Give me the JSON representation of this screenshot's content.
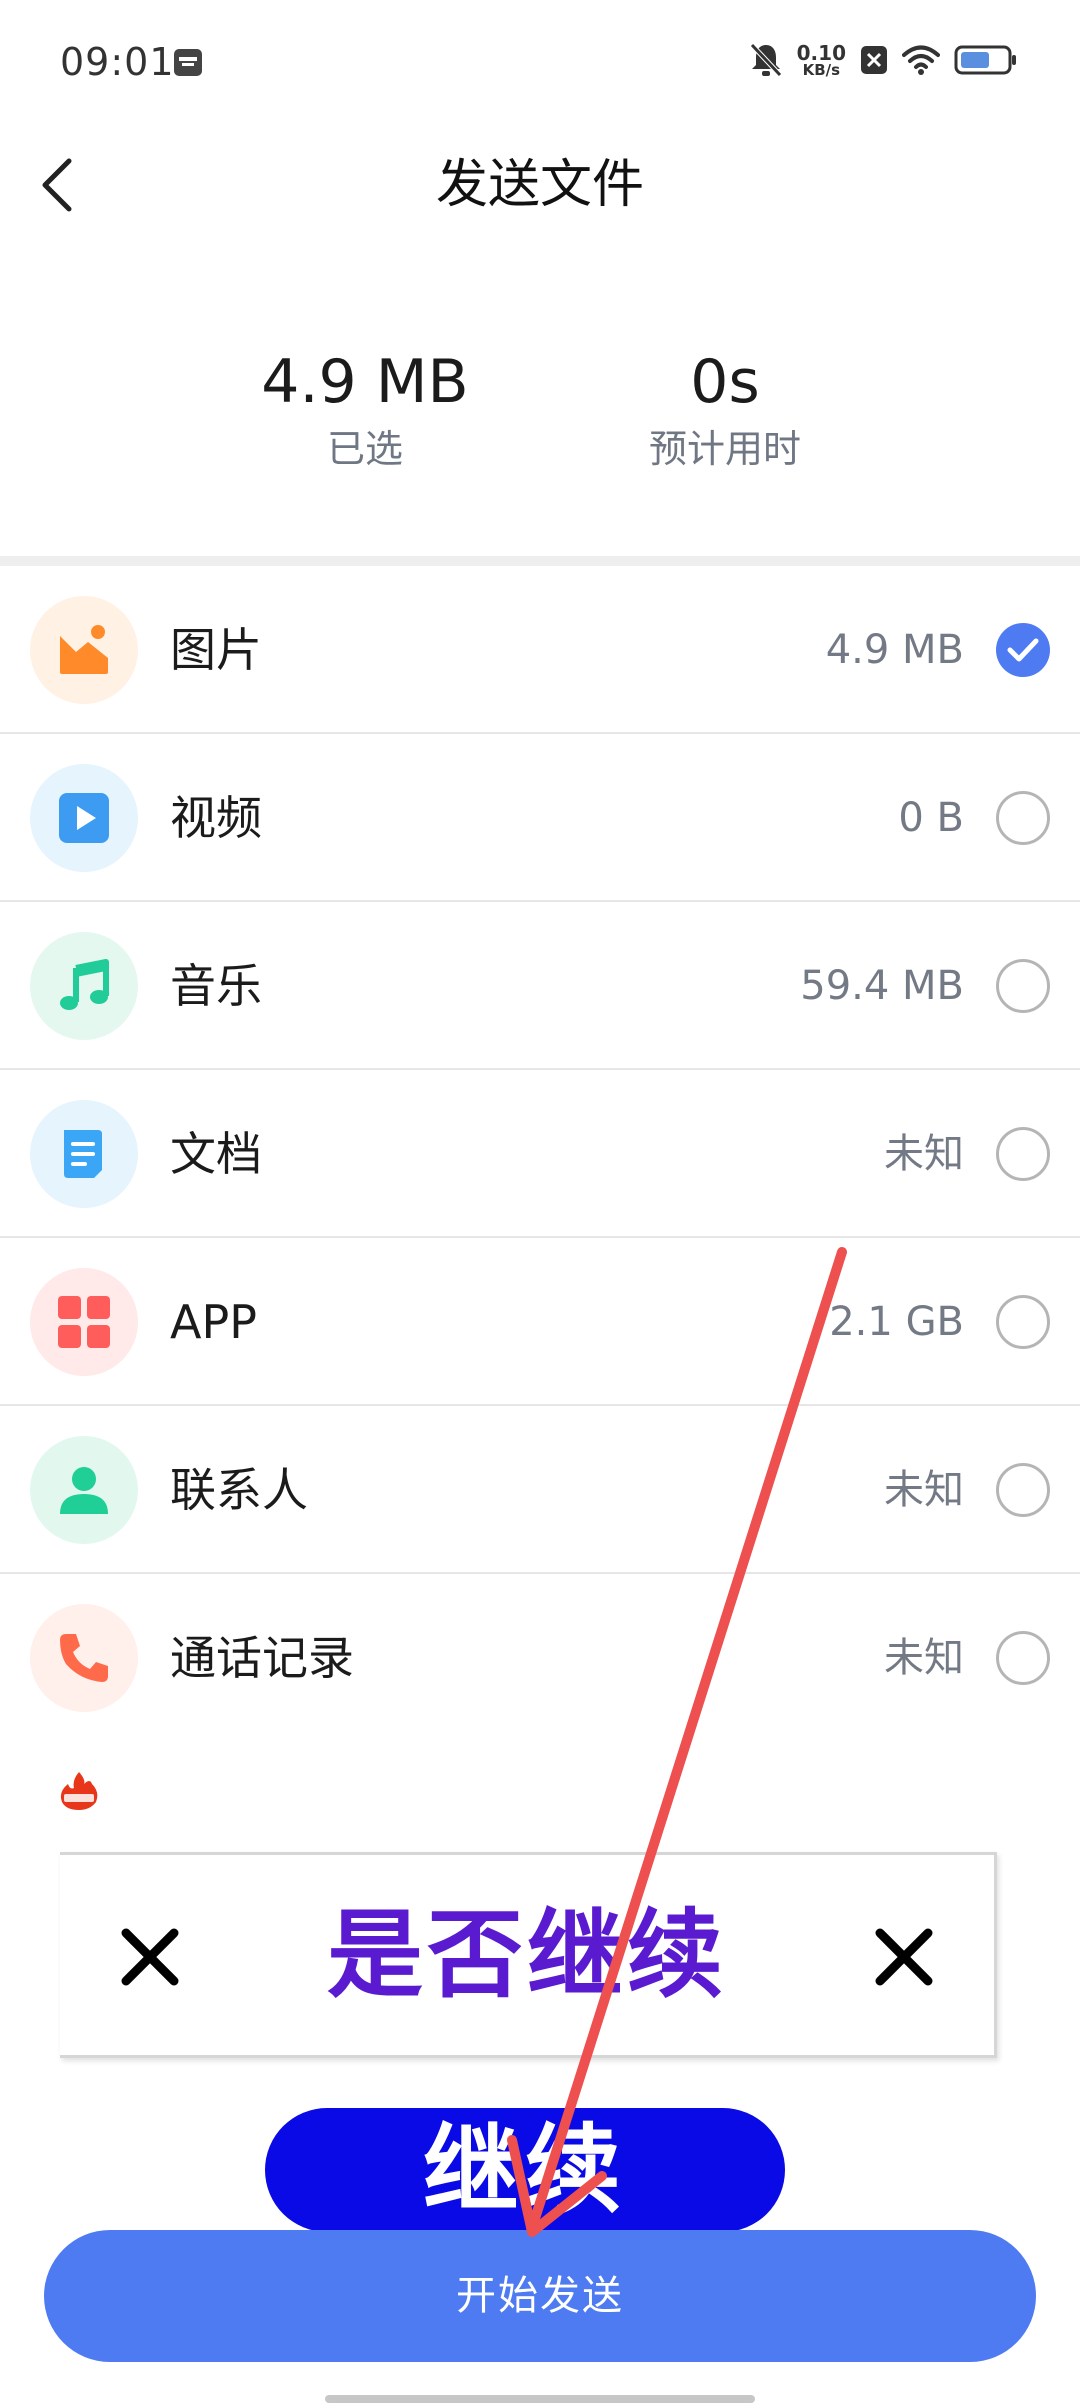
{
  "status_bar": {
    "time": "09:01",
    "net_speed_value": "0.10",
    "net_speed_unit": "KB/s",
    "icons": [
      "calendar-icon",
      "mute-icon",
      "close-icon",
      "wifi-icon",
      "battery-icon"
    ]
  },
  "header": {
    "title": "发送文件",
    "back_icon": "chevron-left-icon"
  },
  "summary": {
    "selected_value": "4.9 MB",
    "selected_label": "已选",
    "time_value": "0s",
    "time_label": "预计用时"
  },
  "categories": [
    {
      "label": "图片",
      "size": "4.9 MB",
      "checked": true,
      "icon": "image-icon",
      "color": "#ff8a2a"
    },
    {
      "label": "视频",
      "size": "0 B",
      "checked": false,
      "icon": "video-icon",
      "color": "#3d9cf2"
    },
    {
      "label": "音乐",
      "size": "59.4 MB",
      "checked": false,
      "icon": "music-icon",
      "color": "#22cc99"
    },
    {
      "label": "文档",
      "size": "未知",
      "checked": false,
      "icon": "document-icon",
      "color": "#3aa6f5"
    },
    {
      "label": "APP",
      "size": "2.1 GB",
      "checked": false,
      "icon": "apps-icon",
      "color": "#ff5c5c"
    },
    {
      "label": "联系人",
      "size": "未知",
      "checked": false,
      "icon": "contact-icon",
      "color": "#1fcf95"
    },
    {
      "label": "通话记录",
      "size": "未知",
      "checked": false,
      "icon": "phone-icon",
      "color": "#ff6b4a"
    }
  ],
  "ad": {
    "prompt": "是否继续",
    "continue_label": "继续"
  },
  "primary_button": {
    "label": "开始发送"
  },
  "colors": {
    "accent": "#4f7bf2",
    "ad_text": "#5a1bd0",
    "ad_button": "#0a0ae6",
    "arrow": "#ee4f4f"
  }
}
